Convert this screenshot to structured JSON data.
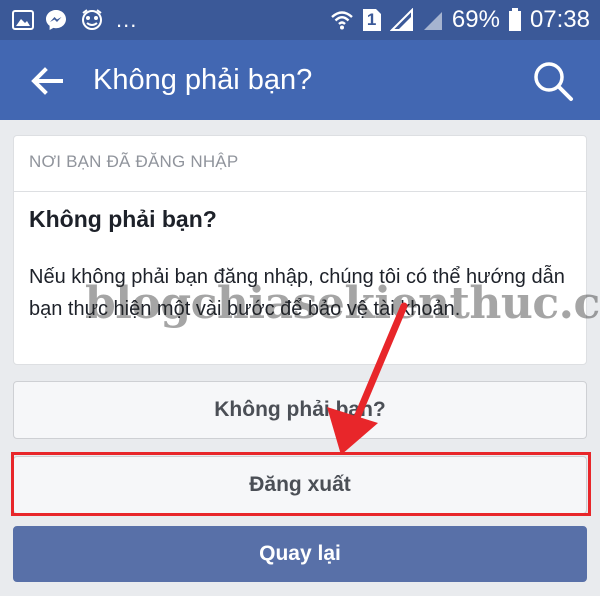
{
  "status_bar": {
    "battery_percent": "69%",
    "time": "07:38",
    "ellipsis": "...",
    "sim_slot": "1"
  },
  "app_bar": {
    "title": "Không phải bạn?"
  },
  "card": {
    "header": "NƠI BẠN ĐÃ ĐĂNG NHẬP",
    "title": "Không phải bạn?",
    "body": "Nếu không phải bạn đăng nhập, chúng tôi có thể hướng dẫn bạn thực hiện một vài bước để bảo vệ tài khoản."
  },
  "buttons": {
    "not_you": "Không phải bạn?",
    "logout": "Đăng xuất",
    "back": "Quay lại"
  },
  "watermark": "blogchiasekienthuc.com",
  "colors": {
    "status_bar": "#3b5998",
    "app_bar": "#4267b2",
    "highlight": "#e8262a",
    "primary_button": "#5870a8"
  },
  "icons": {
    "status": [
      "gallery-icon",
      "messenger-icon",
      "game-icon",
      "wifi-icon",
      "sim-icon",
      "signal-icon",
      "battery-icon"
    ],
    "app_bar": [
      "back-arrow-icon",
      "search-icon"
    ]
  }
}
